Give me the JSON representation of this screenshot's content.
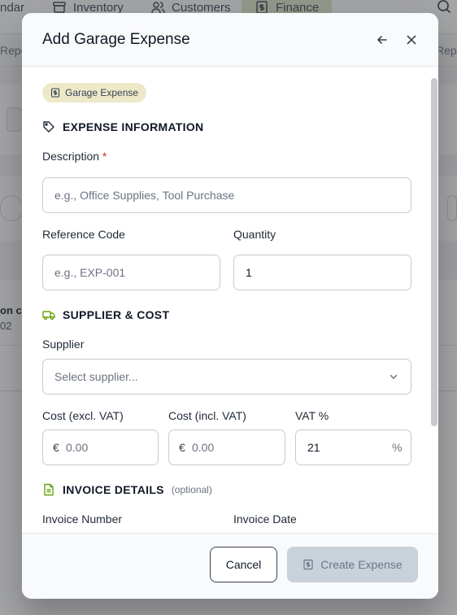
{
  "background": {
    "nav": {
      "calendar_partial": "ndar",
      "inventory": "Inventory",
      "customers": "Customers",
      "finance": "Finance"
    },
    "sub_left": "Repo",
    "sub_right": "Repo",
    "row_text_1": "on co",
    "row_text_2": "02"
  },
  "modal": {
    "title": "Add Garage Expense",
    "badge": "Garage Expense",
    "sections": {
      "expense_info": "EXPENSE INFORMATION",
      "supplier_cost": "SUPPLIER & COST",
      "invoice_details": "INVOICE DETAILS",
      "invoice_optional": "(optional)"
    },
    "fields": {
      "description": {
        "label": "Description",
        "required_mark": "*",
        "placeholder": "e.g., Office Supplies, Tool Purchase",
        "value": ""
      },
      "reference_code": {
        "label": "Reference Code",
        "placeholder": "e.g., EXP-001",
        "value": ""
      },
      "quantity": {
        "label": "Quantity",
        "value": "1"
      },
      "supplier": {
        "label": "Supplier",
        "placeholder": "Select supplier..."
      },
      "cost_excl": {
        "label": "Cost (excl. VAT)",
        "prefix": "€",
        "placeholder": "0.00"
      },
      "cost_incl": {
        "label": "Cost (incl. VAT)",
        "prefix": "€",
        "placeholder": "0.00"
      },
      "vat": {
        "label": "VAT %",
        "value": "21",
        "suffix": "%"
      },
      "invoice_number": {
        "label": "Invoice Number"
      },
      "invoice_date": {
        "label": "Invoice Date"
      }
    },
    "footer": {
      "cancel": "Cancel",
      "create": "Create Expense"
    }
  },
  "colors": {
    "accent_green": "#65a30d",
    "badge_bg": "#ede8c8",
    "disabled_button": "#c9d1db",
    "required": "#dc2626"
  }
}
